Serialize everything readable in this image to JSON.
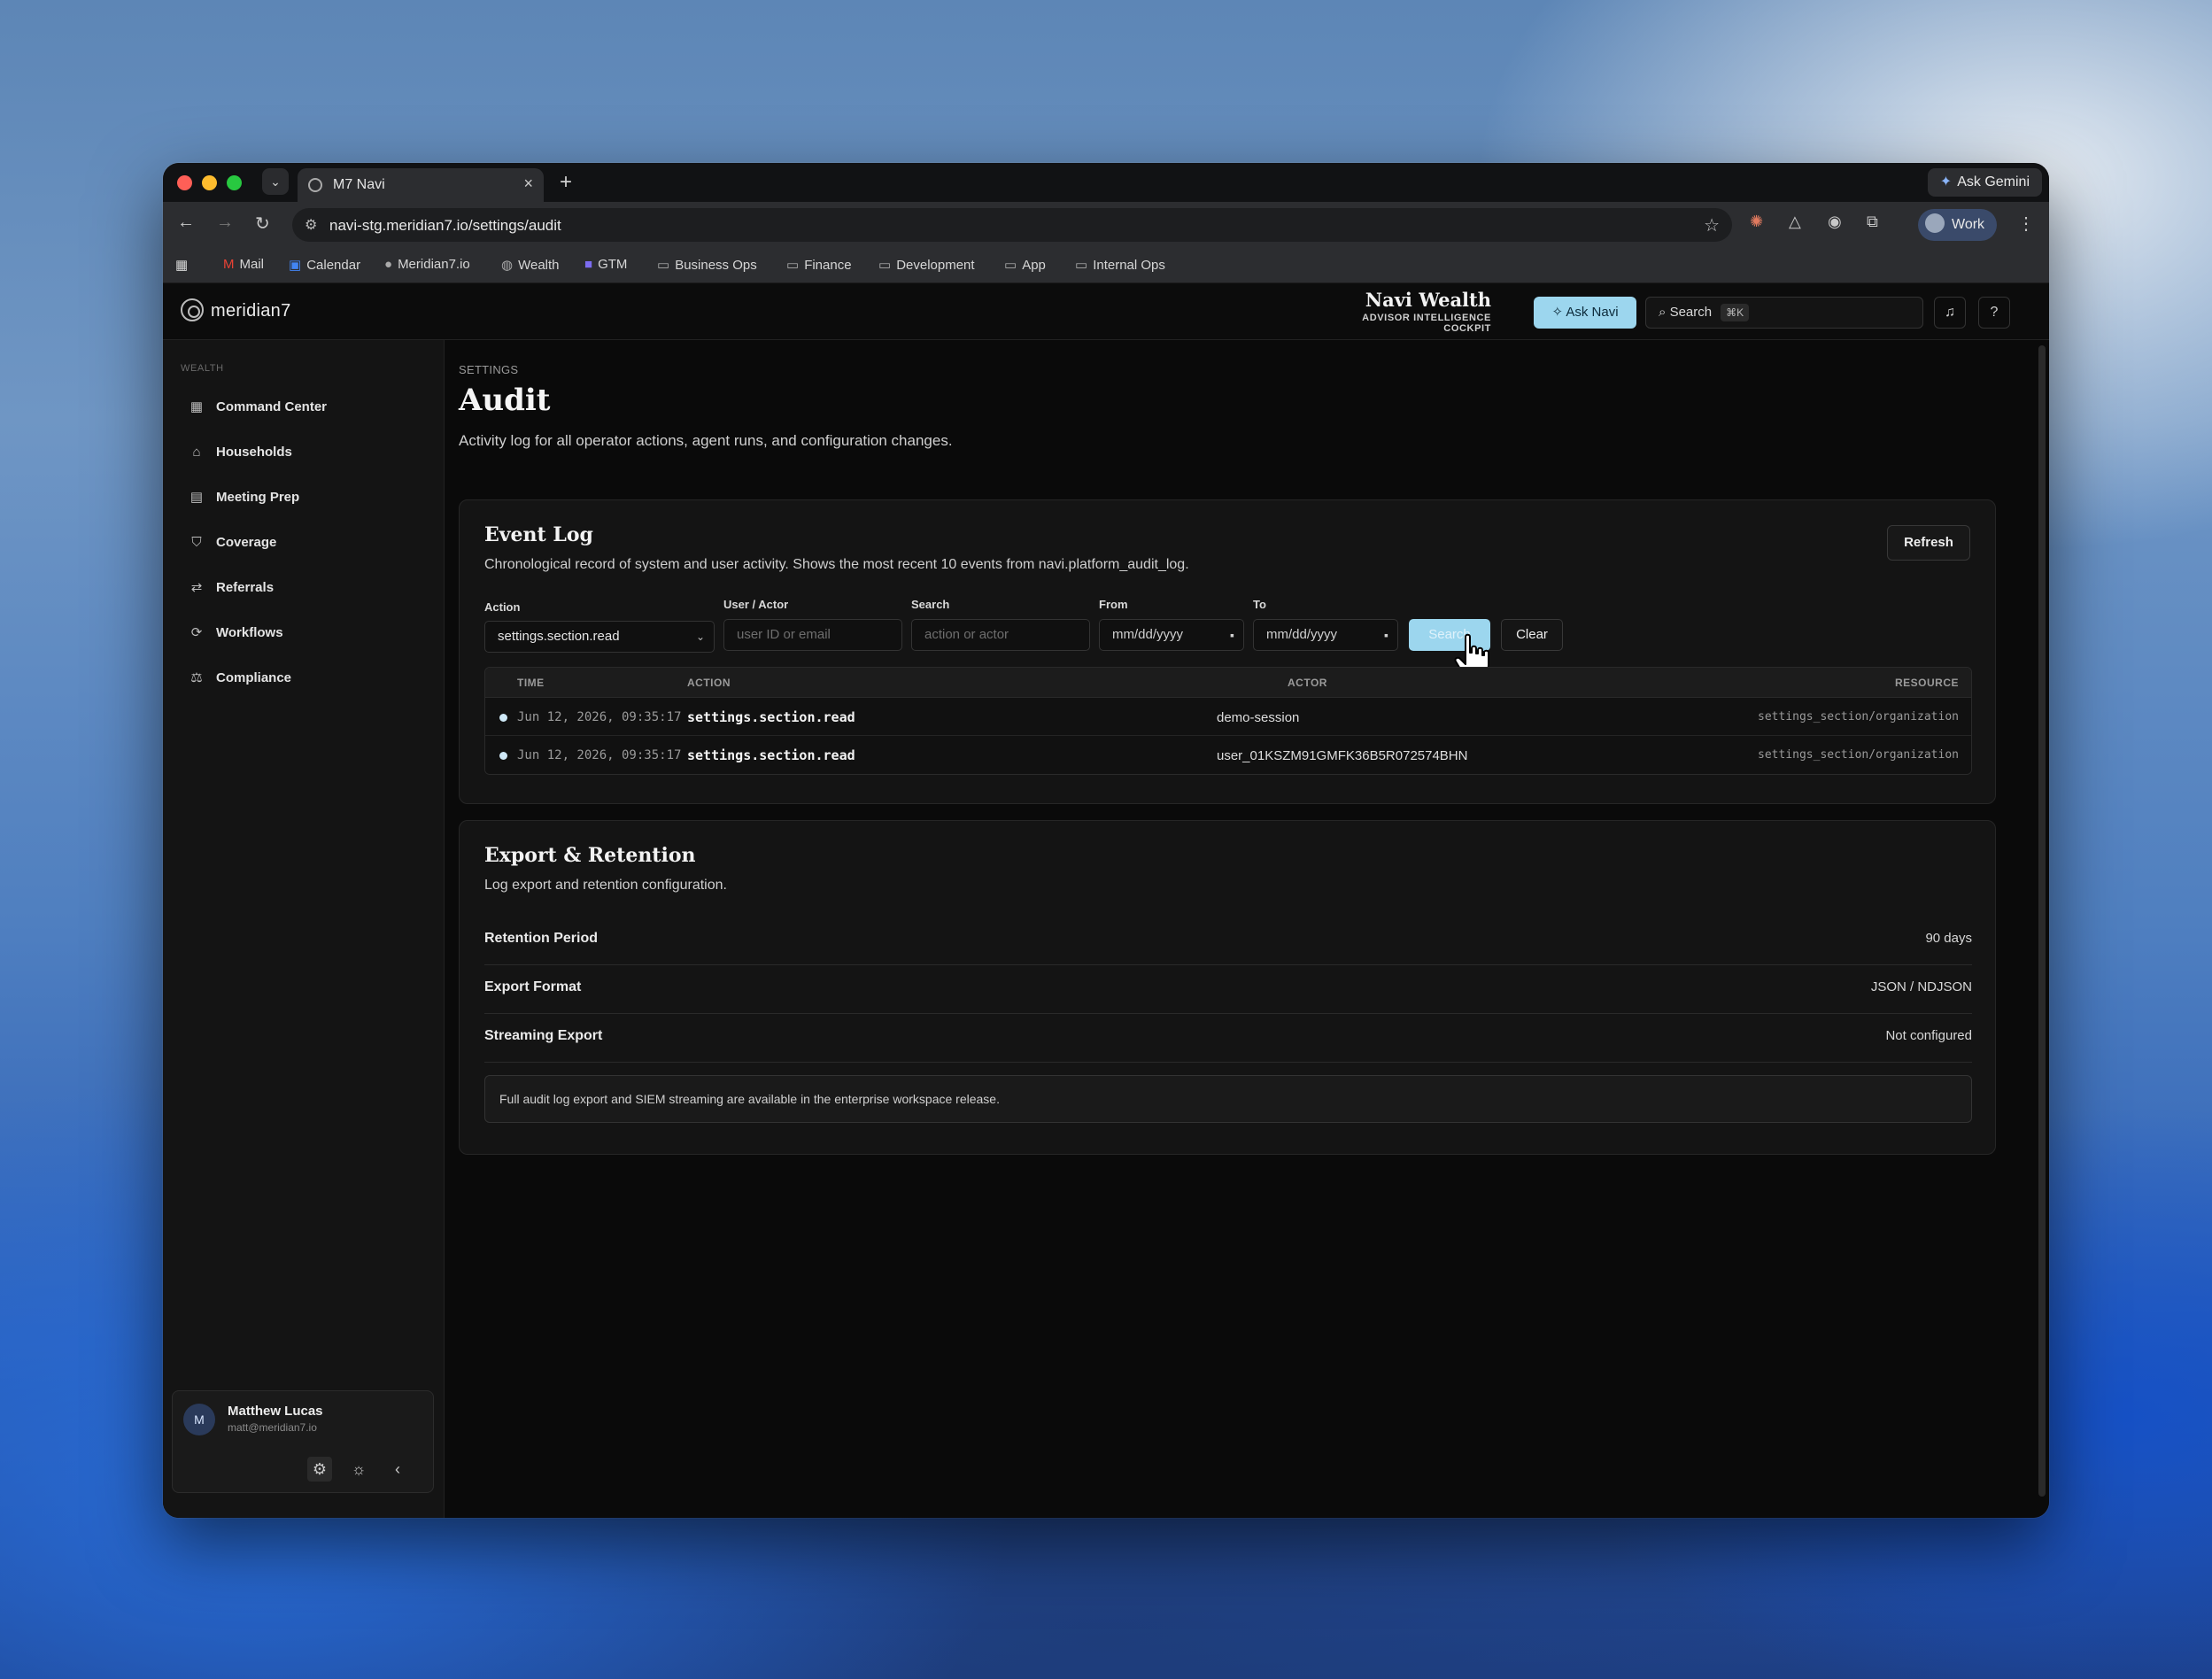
{
  "browser": {
    "tab_title": "M7 Navi",
    "url": "navi-stg.meridian7.io/settings/audit",
    "ask_gemini": "Ask Gemini",
    "profile": "Work",
    "bookmarks": [
      "Mail",
      "Calendar",
      "Meridian7.io",
      "Wealth",
      "GTM",
      "Business Ops",
      "Finance",
      "Development",
      "App",
      "Internal Ops"
    ]
  },
  "topbar": {
    "logo": "meridian7",
    "brand_name": "Navi Wealth",
    "brand_sub": "ADVISOR INTELLIGENCE COCKPIT",
    "ask_navi": "Ask Navi",
    "search_label": "Search",
    "search_kbd": "⌘K"
  },
  "sidebar": {
    "section": "WEALTH",
    "items": [
      {
        "label": "Command Center",
        "icon": "grid-icon"
      },
      {
        "label": "Households",
        "icon": "home-icon"
      },
      {
        "label": "Meeting Prep",
        "icon": "document-icon"
      },
      {
        "label": "Coverage",
        "icon": "shield-icon"
      },
      {
        "label": "Referrals",
        "icon": "swap-icon"
      },
      {
        "label": "Workflows",
        "icon": "workflow-icon"
      },
      {
        "label": "Compliance",
        "icon": "scale-icon"
      }
    ],
    "user": {
      "initial": "M",
      "name": "Matthew Lucas",
      "email": "matt@meridian7.io"
    }
  },
  "page": {
    "crumb": "SETTINGS",
    "title": "Audit",
    "description": "Activity log for all operator actions, agent runs, and configuration changes."
  },
  "event_log": {
    "title": "Event Log",
    "description": "Chronological record of system and user activity. Shows the most recent 10 events from navi.platform_audit_log.",
    "refresh": "Refresh",
    "filters": {
      "action_label": "Action",
      "action_value": "settings.section.read",
      "actor_label": "User / Actor",
      "actor_placeholder": "user ID or email",
      "search_label": "Search",
      "search_placeholder": "action or actor",
      "from_label": "From",
      "from_placeholder": "mm/dd/yyyy",
      "to_label": "To",
      "to_placeholder": "mm/dd/yyyy",
      "search_button": "Search",
      "clear_button": "Clear"
    },
    "columns": [
      "TIME",
      "ACTION",
      "ACTOR",
      "RESOURCE"
    ],
    "rows": [
      {
        "time": "Jun 12, 2026, 09:35:17",
        "action": "settings.section.read",
        "actor": "demo-session",
        "resource": "settings_section/organization"
      },
      {
        "time": "Jun 12, 2026, 09:35:17",
        "action": "settings.section.read",
        "actor": "user_01KSZM91GMFK36B5R072574BHN",
        "resource": "settings_section/organization"
      }
    ]
  },
  "export": {
    "title": "Export & Retention",
    "description": "Log export and retention configuration.",
    "rows": [
      {
        "key": "Retention Period",
        "value": "90 days"
      },
      {
        "key": "Export Format",
        "value": "JSON / NDJSON"
      },
      {
        "key": "Streaming Export",
        "value": "Not configured"
      }
    ],
    "note": "Full audit log export and SIEM streaming are available in the enterprise workspace release."
  },
  "colors": {
    "accent": "#9cd6ee",
    "app_bg": "#0a0a0a",
    "card_bg": "#141414"
  }
}
